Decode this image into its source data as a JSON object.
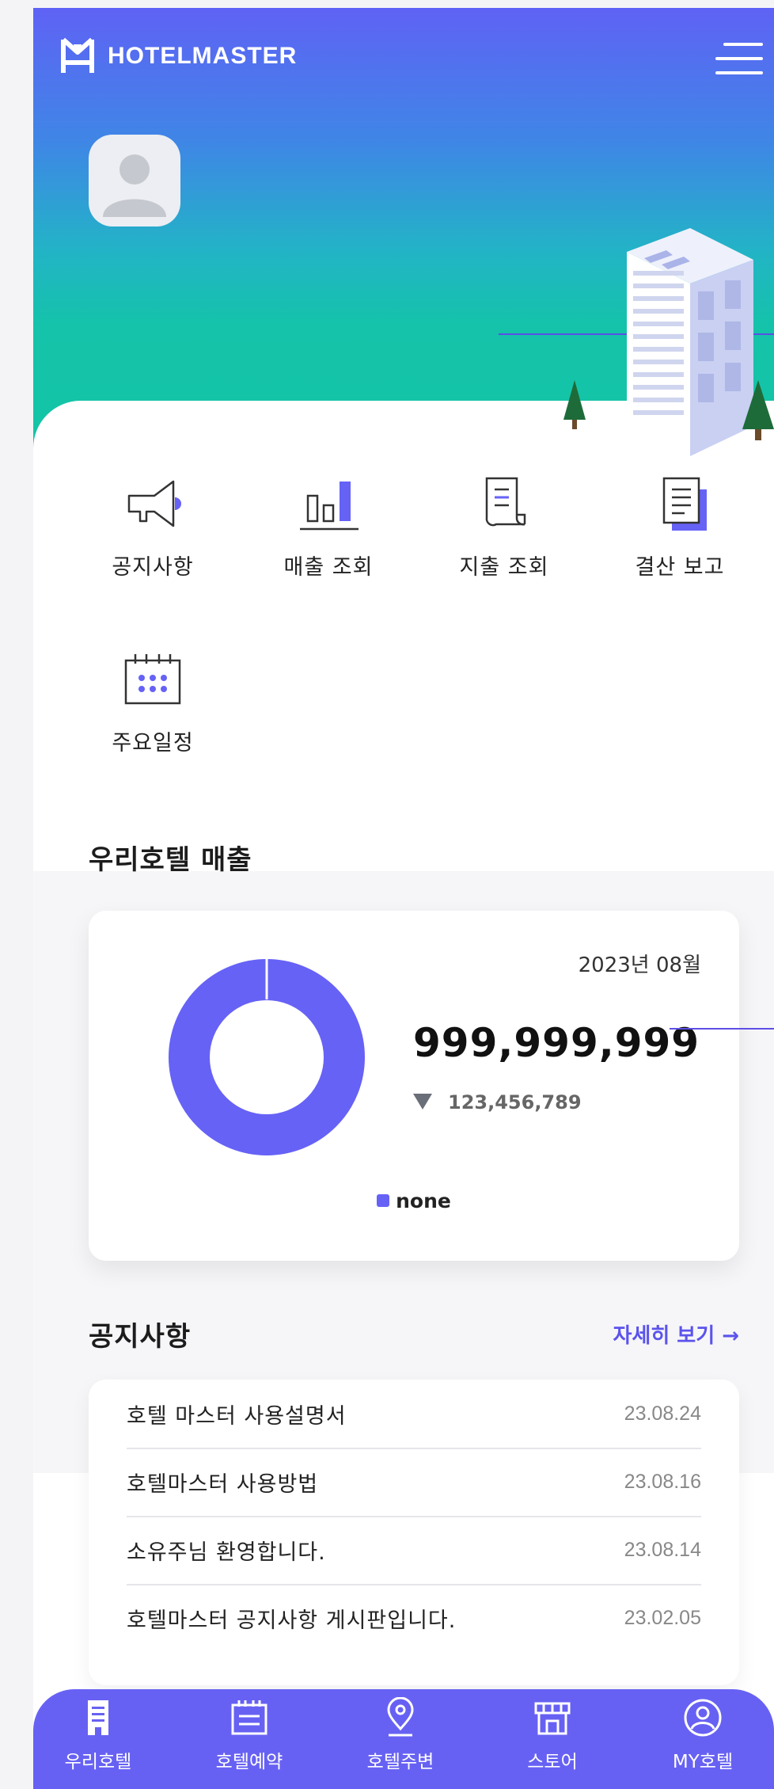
{
  "header": {
    "brand": "HOTELMASTER"
  },
  "quick_menu": [
    {
      "label": "공지사항",
      "icon": "megaphone-icon"
    },
    {
      "label": "매출 조회",
      "icon": "bar-chart-icon"
    },
    {
      "label": "지출 조회",
      "icon": "receipt-icon"
    },
    {
      "label": "결산 보고",
      "icon": "document-icon"
    },
    {
      "label": "주요일정",
      "icon": "calendar-icon"
    }
  ],
  "sales": {
    "title": "우리호텔 매출",
    "period": "2023년 08월",
    "amount": "999,999,999",
    "difference": "123,456,789"
  },
  "chart_data": {
    "type": "pie",
    "categories": [
      "none"
    ],
    "values": [
      100
    ],
    "colors": [
      "#6662f6"
    ],
    "legend": "bottom"
  },
  "notice": {
    "title": "공지사항",
    "more_label": "자세히 보기 →",
    "items": [
      {
        "title": "호텔 마스터 사용설명서",
        "date": "23.08.24"
      },
      {
        "title": "호텔마스터 사용방법",
        "date": "23.08.16"
      },
      {
        "title": "소유주님 환영합니다.",
        "date": "23.08.14"
      },
      {
        "title": "호텔마스터 공지사항 게시판입니다.",
        "date": "23.02.05"
      }
    ]
  },
  "tabbar": [
    {
      "label": "우리호텔",
      "icon": "building-icon"
    },
    {
      "label": "호텔예약",
      "icon": "calendar-icon"
    },
    {
      "label": "호텔주변",
      "icon": "location-pin-icon"
    },
    {
      "label": "스토어",
      "icon": "store-icon"
    },
    {
      "label": "MY호텔",
      "icon": "user-circle-icon"
    }
  ],
  "colors": {
    "accent": "#6761f3",
    "chart": "#6662f6"
  }
}
